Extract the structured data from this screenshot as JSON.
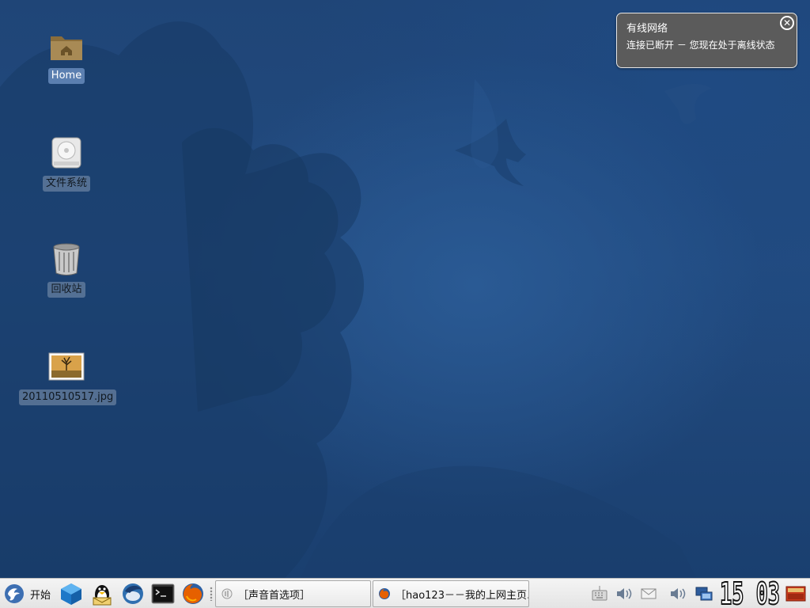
{
  "desktop": {
    "icons": [
      {
        "label": "Home",
        "icon": "home-folder-icon"
      },
      {
        "label": "文件系统",
        "icon": "harddisk-icon"
      },
      {
        "label": "回收站",
        "icon": "trash-icon"
      },
      {
        "label": "20110510517.jpg",
        "icon": "image-file-icon"
      }
    ]
  },
  "notification": {
    "title": "有线网络",
    "body": "连接已断开 － 您现在处于离线状态",
    "close_icon": "close-circle-icon"
  },
  "panel": {
    "start_label": "开始",
    "launchers": [
      "cube-app-icon",
      "qq-penguin-icon",
      "thunderbird-icon",
      "terminal-icon",
      "firefox-icon"
    ],
    "tasks": [
      {
        "label": "［声音首选项］",
        "icon": "sound-preferences-icon"
      },
      {
        "label": "［hao123－－我的上网主页…",
        "icon": "firefox-icon"
      }
    ],
    "tray": [
      "keyboard-icon",
      "volume-icon",
      "mail-icon",
      "volume-icon",
      "network-icon"
    ],
    "clock": "15 03",
    "show_desktop_icon": "show-desktop-icon"
  },
  "colors": {
    "desktop_bg": "#1d4579",
    "panel_bg": "#e9e9e9",
    "notify_bg": "#5b5b5b",
    "selected_label": "#5b7fb0"
  }
}
